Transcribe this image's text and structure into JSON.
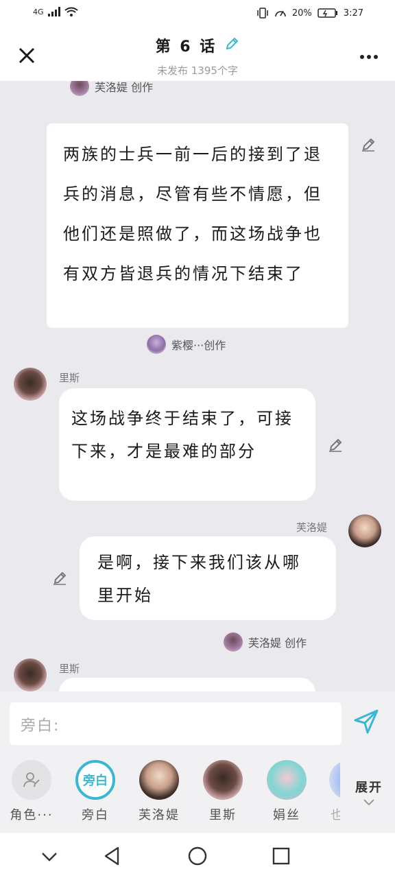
{
  "status_bar": {
    "network": "4G",
    "battery": "20%",
    "time": "3:27"
  },
  "header": {
    "title": "第 6 话",
    "subtitle": "未发布 1395个字"
  },
  "chat": {
    "credit_1": "芙洛媞 创作",
    "narration": "两族的士兵一前一后的接到了退兵的消息，尽管有些不情愿，但他们还是照做了，而这场战争也有双方皆退兵的情况下结束了",
    "credit_2": "紫樱···创作",
    "msg_1": {
      "name": "里斯",
      "text": "这场战争终于结束了，可接下来，才是最难的部分"
    },
    "msg_2": {
      "name": "芙洛媞",
      "text": "是啊，接下来我们该从哪里开始"
    },
    "credit_3": "芙洛媞 创作",
    "msg_3": {
      "name": "里斯"
    }
  },
  "composer": {
    "placeholder": "旁白:",
    "roles": [
      {
        "label": "角色···",
        "icon": "add-role-icon"
      },
      {
        "label": "旁白",
        "badge": "旁白"
      },
      {
        "label": "芙洛媞"
      },
      {
        "label": "里斯"
      },
      {
        "label": "娟丝"
      },
      {
        "label": "也"
      }
    ],
    "expand_label": "展开"
  },
  "colors": {
    "accent": "#3ab7d4",
    "background": "#e9e9ee"
  }
}
